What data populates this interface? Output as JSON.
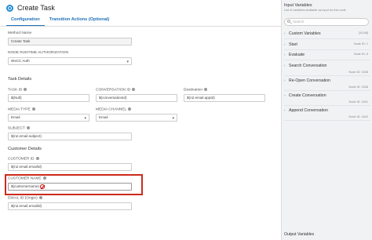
{
  "header": {
    "title": "Create Task"
  },
  "tabs": [
    {
      "label": "Configuration"
    },
    {
      "label": "Transition Actions (Optional)"
    }
  ],
  "form": {
    "method_name": {
      "label": "Method Name",
      "value": "Create Task"
    },
    "node_runtime_auth": {
      "label": "NODE RUNTIME AUTHORIZATION",
      "value": "WxCC Auth"
    },
    "task_details_heading": "Task Details",
    "task_id": {
      "label": "TASK ID",
      "value": "$(Null)"
    },
    "conversation_id": {
      "label": "CONVERSATION ID",
      "value": "$(conversationId)"
    },
    "destination": {
      "label": "Destination",
      "value": "$(n2.email.appId)"
    },
    "media_type": {
      "label": "MEDIA TYPE",
      "value": "Email"
    },
    "media_channel": {
      "label": "MEDIA CHANNEL",
      "value": "Email"
    },
    "subject": {
      "label": "SUBJECT",
      "value": "$(n2.email.subject)"
    },
    "customer_details_heading": "Customer Details",
    "customer_id": {
      "label": "CUSTOMER ID",
      "value": "$(n2.email.emailId)"
    },
    "customer_name": {
      "label": "CUSTOMER NAME",
      "value": "$(customername)"
    },
    "email_id": {
      "label": "EMAIL ID (Origin)",
      "value": "$(n2.email.emailId)"
    }
  },
  "sidebar": {
    "title": "Input Variables",
    "subtitle": "List of variables available as input for this node",
    "search_placeholder": "Search",
    "items": [
      {
        "label": "Custom Variables",
        "meta": "[11166]",
        "meta2": ""
      },
      {
        "label": "Start",
        "meta": "Node ID: 1",
        "meta2": ""
      },
      {
        "label": "Evaluate",
        "meta": "Node ID: 6",
        "meta2": ""
      },
      {
        "label": "Search Conversation",
        "meta": "",
        "meta2": "Node ID: 1636"
      },
      {
        "label": "Re-Open Conversation",
        "meta": "",
        "meta2": "Node ID: 1638"
      },
      {
        "label": "Create Conversation",
        "meta": "",
        "meta2": "Node ID: 1641"
      },
      {
        "label": "Append Conversation",
        "meta": "",
        "meta2": "Node ID: 1642"
      }
    ],
    "output_title": "Output Variables"
  }
}
